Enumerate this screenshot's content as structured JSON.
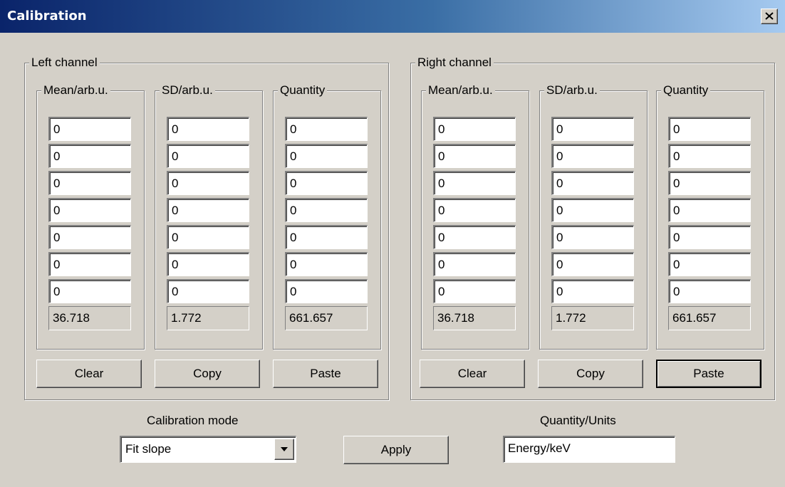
{
  "window": {
    "title": "Calibration",
    "close_glyph": "×"
  },
  "left_channel": {
    "label": "Left channel",
    "columns": [
      {
        "label": "Mean/arb.u.",
        "values": [
          "0",
          "0",
          "0",
          "0",
          "0",
          "0",
          "0"
        ],
        "result": "36.718"
      },
      {
        "label": "SD/arb.u.",
        "values": [
          "0",
          "0",
          "0",
          "0",
          "0",
          "0",
          "0"
        ],
        "result": "1.772"
      },
      {
        "label": "Quantity",
        "values": [
          "0",
          "0",
          "0",
          "0",
          "0",
          "0",
          "0"
        ],
        "result": "661.657"
      }
    ],
    "buttons": [
      "Clear",
      "Copy",
      "Paste"
    ]
  },
  "right_channel": {
    "label": "Right channel",
    "columns": [
      {
        "label": "Mean/arb.u.",
        "values": [
          "0",
          "0",
          "0",
          "0",
          "0",
          "0",
          "0"
        ],
        "result": "36.718"
      },
      {
        "label": "SD/arb.u.",
        "values": [
          "0",
          "0",
          "0",
          "0",
          "0",
          "0",
          "0"
        ],
        "result": "1.772"
      },
      {
        "label": "Quantity",
        "values": [
          "0",
          "0",
          "0",
          "0",
          "0",
          "0",
          "0"
        ],
        "result": "661.657"
      }
    ],
    "buttons": [
      "Clear",
      "Copy",
      "Paste"
    ]
  },
  "calibration_mode": {
    "label": "Calibration mode",
    "value": "Fit slope"
  },
  "apply_button": "Apply",
  "quantity_units": {
    "label": "Quantity/Units",
    "value": "Energy/keV"
  }
}
